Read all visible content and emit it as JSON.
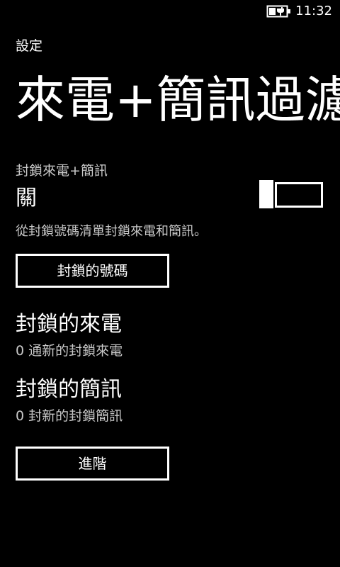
{
  "status_bar": {
    "battery_icon": "battery-charging-icon",
    "time": "11:32"
  },
  "header": {
    "app_title": "設定",
    "page_title": "來電+簡訊過濾"
  },
  "block_toggle": {
    "label": "封鎖來電+簡訊",
    "state": "關",
    "value": false,
    "description": "從封鎖號碼清單封鎖來電和簡訊。"
  },
  "buttons": {
    "blocked_numbers": "封鎖的號碼",
    "advanced": "進階"
  },
  "blocked_calls": {
    "title": "封鎖的來電",
    "subtitle": "0 通新的封鎖來電"
  },
  "blocked_sms": {
    "title": "封鎖的簡訊",
    "subtitle": "0 封新的封鎖簡訊"
  },
  "colors": {
    "background": "#000000",
    "foreground": "#ffffff",
    "secondary_text": "#c9c9c9"
  }
}
